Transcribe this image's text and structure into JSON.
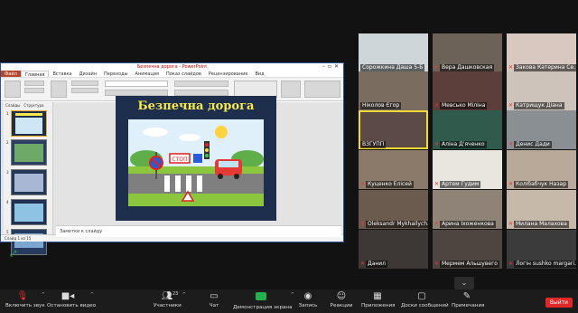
{
  "ppt": {
    "title": "Безпечна дорога - PowerPoint",
    "tabs": [
      "Файл",
      "Главная",
      "Вставка",
      "Дизайн",
      "Переходы",
      "Анимация",
      "Показ слайдов",
      "Рецензирование",
      "Вид"
    ],
    "thumb_tabs": [
      "Слайды",
      "Структура"
    ],
    "slide_numbers": [
      "1",
      "2",
      "3",
      "4",
      "5"
    ],
    "slide_title": "Безпечна дорога",
    "sign_text": "СТОП",
    "notes_placeholder": "Заметки к слайду",
    "status": "Слайд 1 из 15"
  },
  "participants": [
    {
      "name": "Сорожкина Даша 5-Б",
      "mic_off": false,
      "active": false
    },
    {
      "name": "Вера Дашковская",
      "mic_off": true,
      "active": false
    },
    {
      "name": "Закова Катерина Се...",
      "mic_off": true,
      "active": false
    },
    {
      "name": "Ніколов Єгор",
      "mic_off": false,
      "active": false
    },
    {
      "name": "Мевсько Міліна",
      "mic_off": true,
      "active": false
    },
    {
      "name": "Катрищук Діана",
      "mic_off": true,
      "active": false
    },
    {
      "name": "ВЗГУПП",
      "mic_off": false,
      "active": true
    },
    {
      "name": "Аліна Д'яченко",
      "mic_off": true,
      "active": false
    },
    {
      "name": "Денис Дади",
      "mic_off": true,
      "active": false
    },
    {
      "name": "Куценко Елісей",
      "mic_off": true,
      "active": false
    },
    {
      "name": "Артем Гудим",
      "mic_off": true,
      "active": false
    },
    {
      "name": "Колібабчук Назар",
      "mic_off": true,
      "active": false
    },
    {
      "name": "Oleksandr Mykhailych...",
      "mic_off": true,
      "active": false
    },
    {
      "name": "Арина Іхоженкова",
      "mic_off": true,
      "active": false
    },
    {
      "name": "Милана Малахова",
      "mic_off": true,
      "active": false
    },
    {
      "name": "Данил",
      "mic_off": true,
      "active": false
    },
    {
      "name": "Мермем Альшувего",
      "mic_off": true,
      "active": false
    },
    {
      "name": "Логін sushko margari...",
      "mic_off": true,
      "active": false
    }
  ],
  "toolbar": {
    "unmute": "Включить звук",
    "stop_video": "Остановить видео",
    "participants": "Участники",
    "participants_count": "23",
    "chat": "Чат",
    "share": "Демонстрация экрана",
    "record": "Запись",
    "reactions": "Реакции",
    "apps": "Приложения",
    "whiteboards": "Доски сообщений",
    "notes": "Примечания",
    "leave": "Выйти"
  },
  "colors": {
    "share_green": "#22b14c",
    "leave_red": "#e02828",
    "active_speaker": "#f5d93a",
    "slide_bg": "#1e2f4e",
    "slide_title": "#f7e94a"
  }
}
